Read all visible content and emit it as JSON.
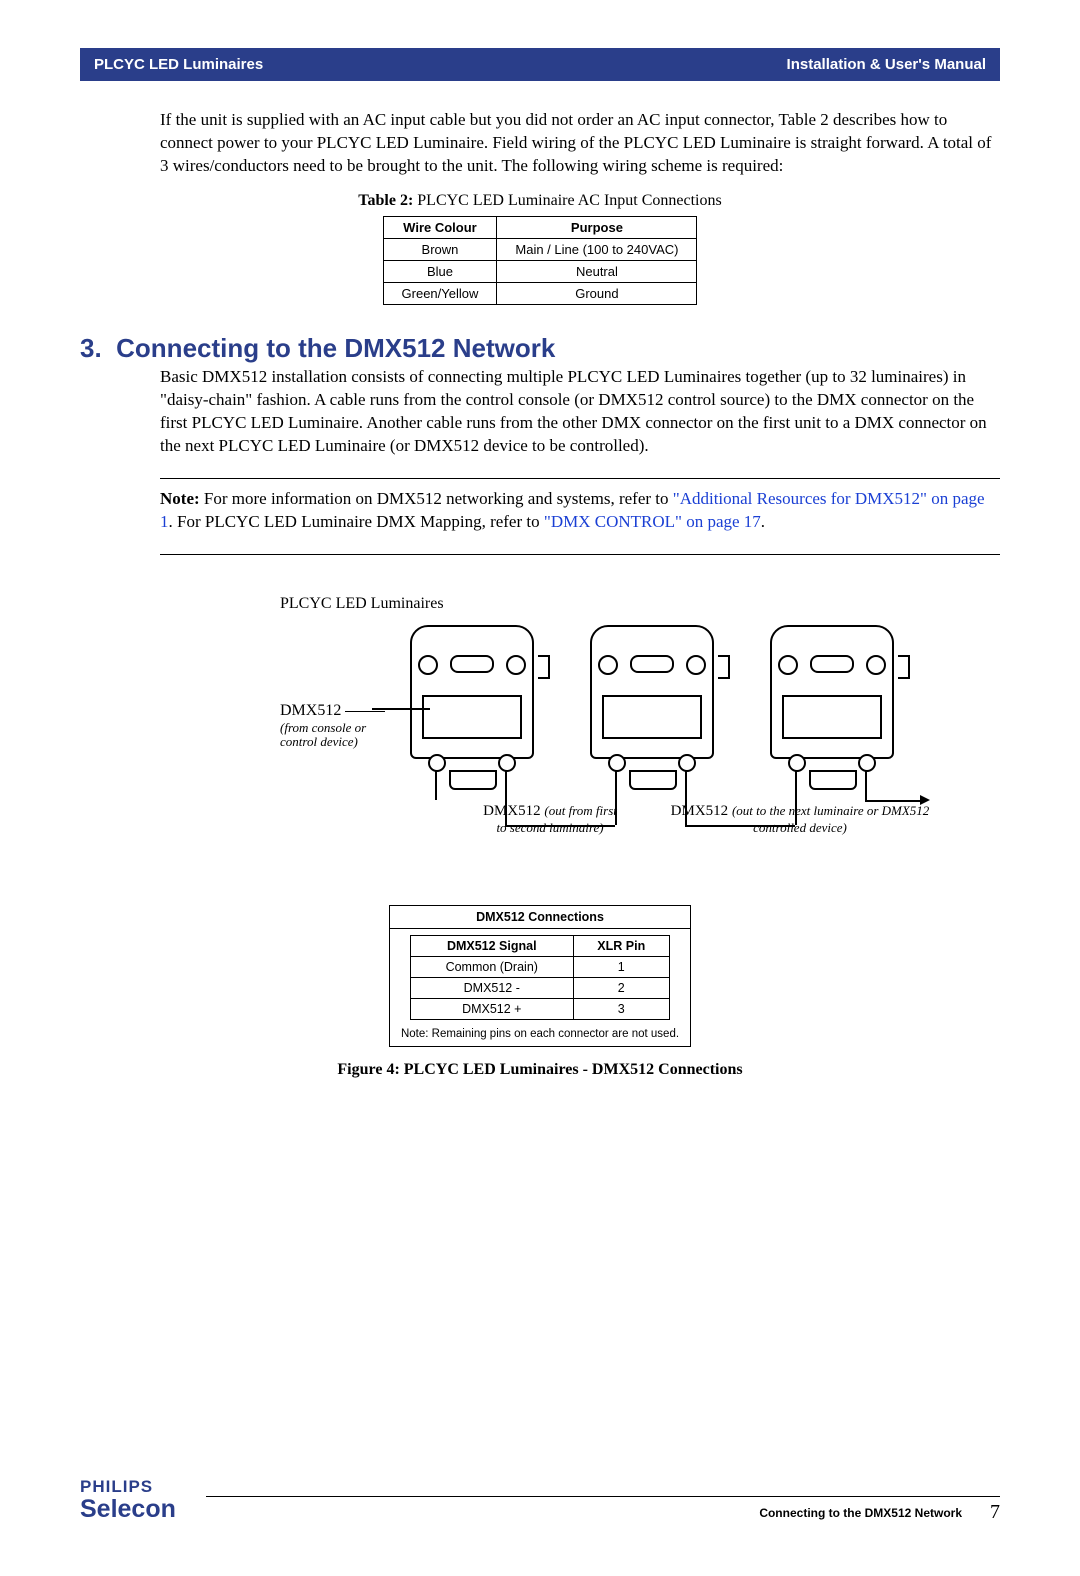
{
  "header": {
    "left": "PLCYC LED Luminaires",
    "right": "Installation & User's Manual"
  },
  "intro_para": "If the unit is supplied with an AC input cable but you did not order an AC input connector, Table 2 describes how to connect power to your PLCYC LED Luminaire. Field wiring of the PLCYC LED Luminaire is straight forward. A total of 3 wires/conductors need to be brought to the unit. The following wiring scheme is required:",
  "table2": {
    "caption_label": "Table 2:",
    "caption_rest": " PLCYC LED Luminaire AC Input Connections",
    "headers": [
      "Wire Colour",
      "Purpose"
    ],
    "rows": [
      [
        "Brown",
        "Main / Line (100 to 240VAC)"
      ],
      [
        "Blue",
        "Neutral"
      ],
      [
        "Green/Yellow",
        "Ground"
      ]
    ]
  },
  "section": {
    "num": "3.",
    "title": "Connecting to the DMX512 Network",
    "para": "Basic DMX512 installation consists of connecting multiple PLCYC LED Luminaires together (up to 32 luminaires) in \"daisy-chain\" fashion. A cable runs from the control console (or DMX512 control source) to the DMX connector on the first PLCYC LED Luminaire. Another cable runs from the other DMX connector on the first unit to a DMX connector on the next PLCYC LED Luminaire (or DMX512 device to be controlled)."
  },
  "note": {
    "prefix": "Note:",
    "t1": "  For more information on DMX512 networking and systems, refer to ",
    "link1": "\"Additional Resources for DMX512\" on page 1",
    "t2": ". For PLCYC LED Luminaire DMX Mapping, refer to ",
    "link2": "\"DMX CONTROL\" on page 17",
    "t3": "."
  },
  "diagram": {
    "top_label": "PLCYC LED Luminaires",
    "dmx_label": "DMX512",
    "dmx_sub1": "(from console or",
    "dmx_sub2": "control device)",
    "mid1_a": "DMX512",
    "mid1_b": "(out from first",
    "mid1_c": "to second luminaire)",
    "mid2_a": "DMX512",
    "mid2_b": "(out to the next luminaire or DMX512",
    "mid2_c": "controlled device)"
  },
  "dmx_table": {
    "title": "DMX512 Connections",
    "headers": [
      "DMX512 Signal",
      "XLR Pin"
    ],
    "rows": [
      [
        "Common (Drain)",
        "1"
      ],
      [
        "DMX512 -",
        "2"
      ],
      [
        "DMX512 +",
        "3"
      ]
    ],
    "note": "Note: Remaining pins on each connector are not used."
  },
  "figure_caption": "Figure 4:  PLCYC LED Luminaires - DMX512 Connections",
  "footer": {
    "brand_top": "PHILIPS",
    "brand_bottom": "Selecon",
    "section_ref": "Connecting to the DMX512 Network",
    "page_num": "7"
  }
}
